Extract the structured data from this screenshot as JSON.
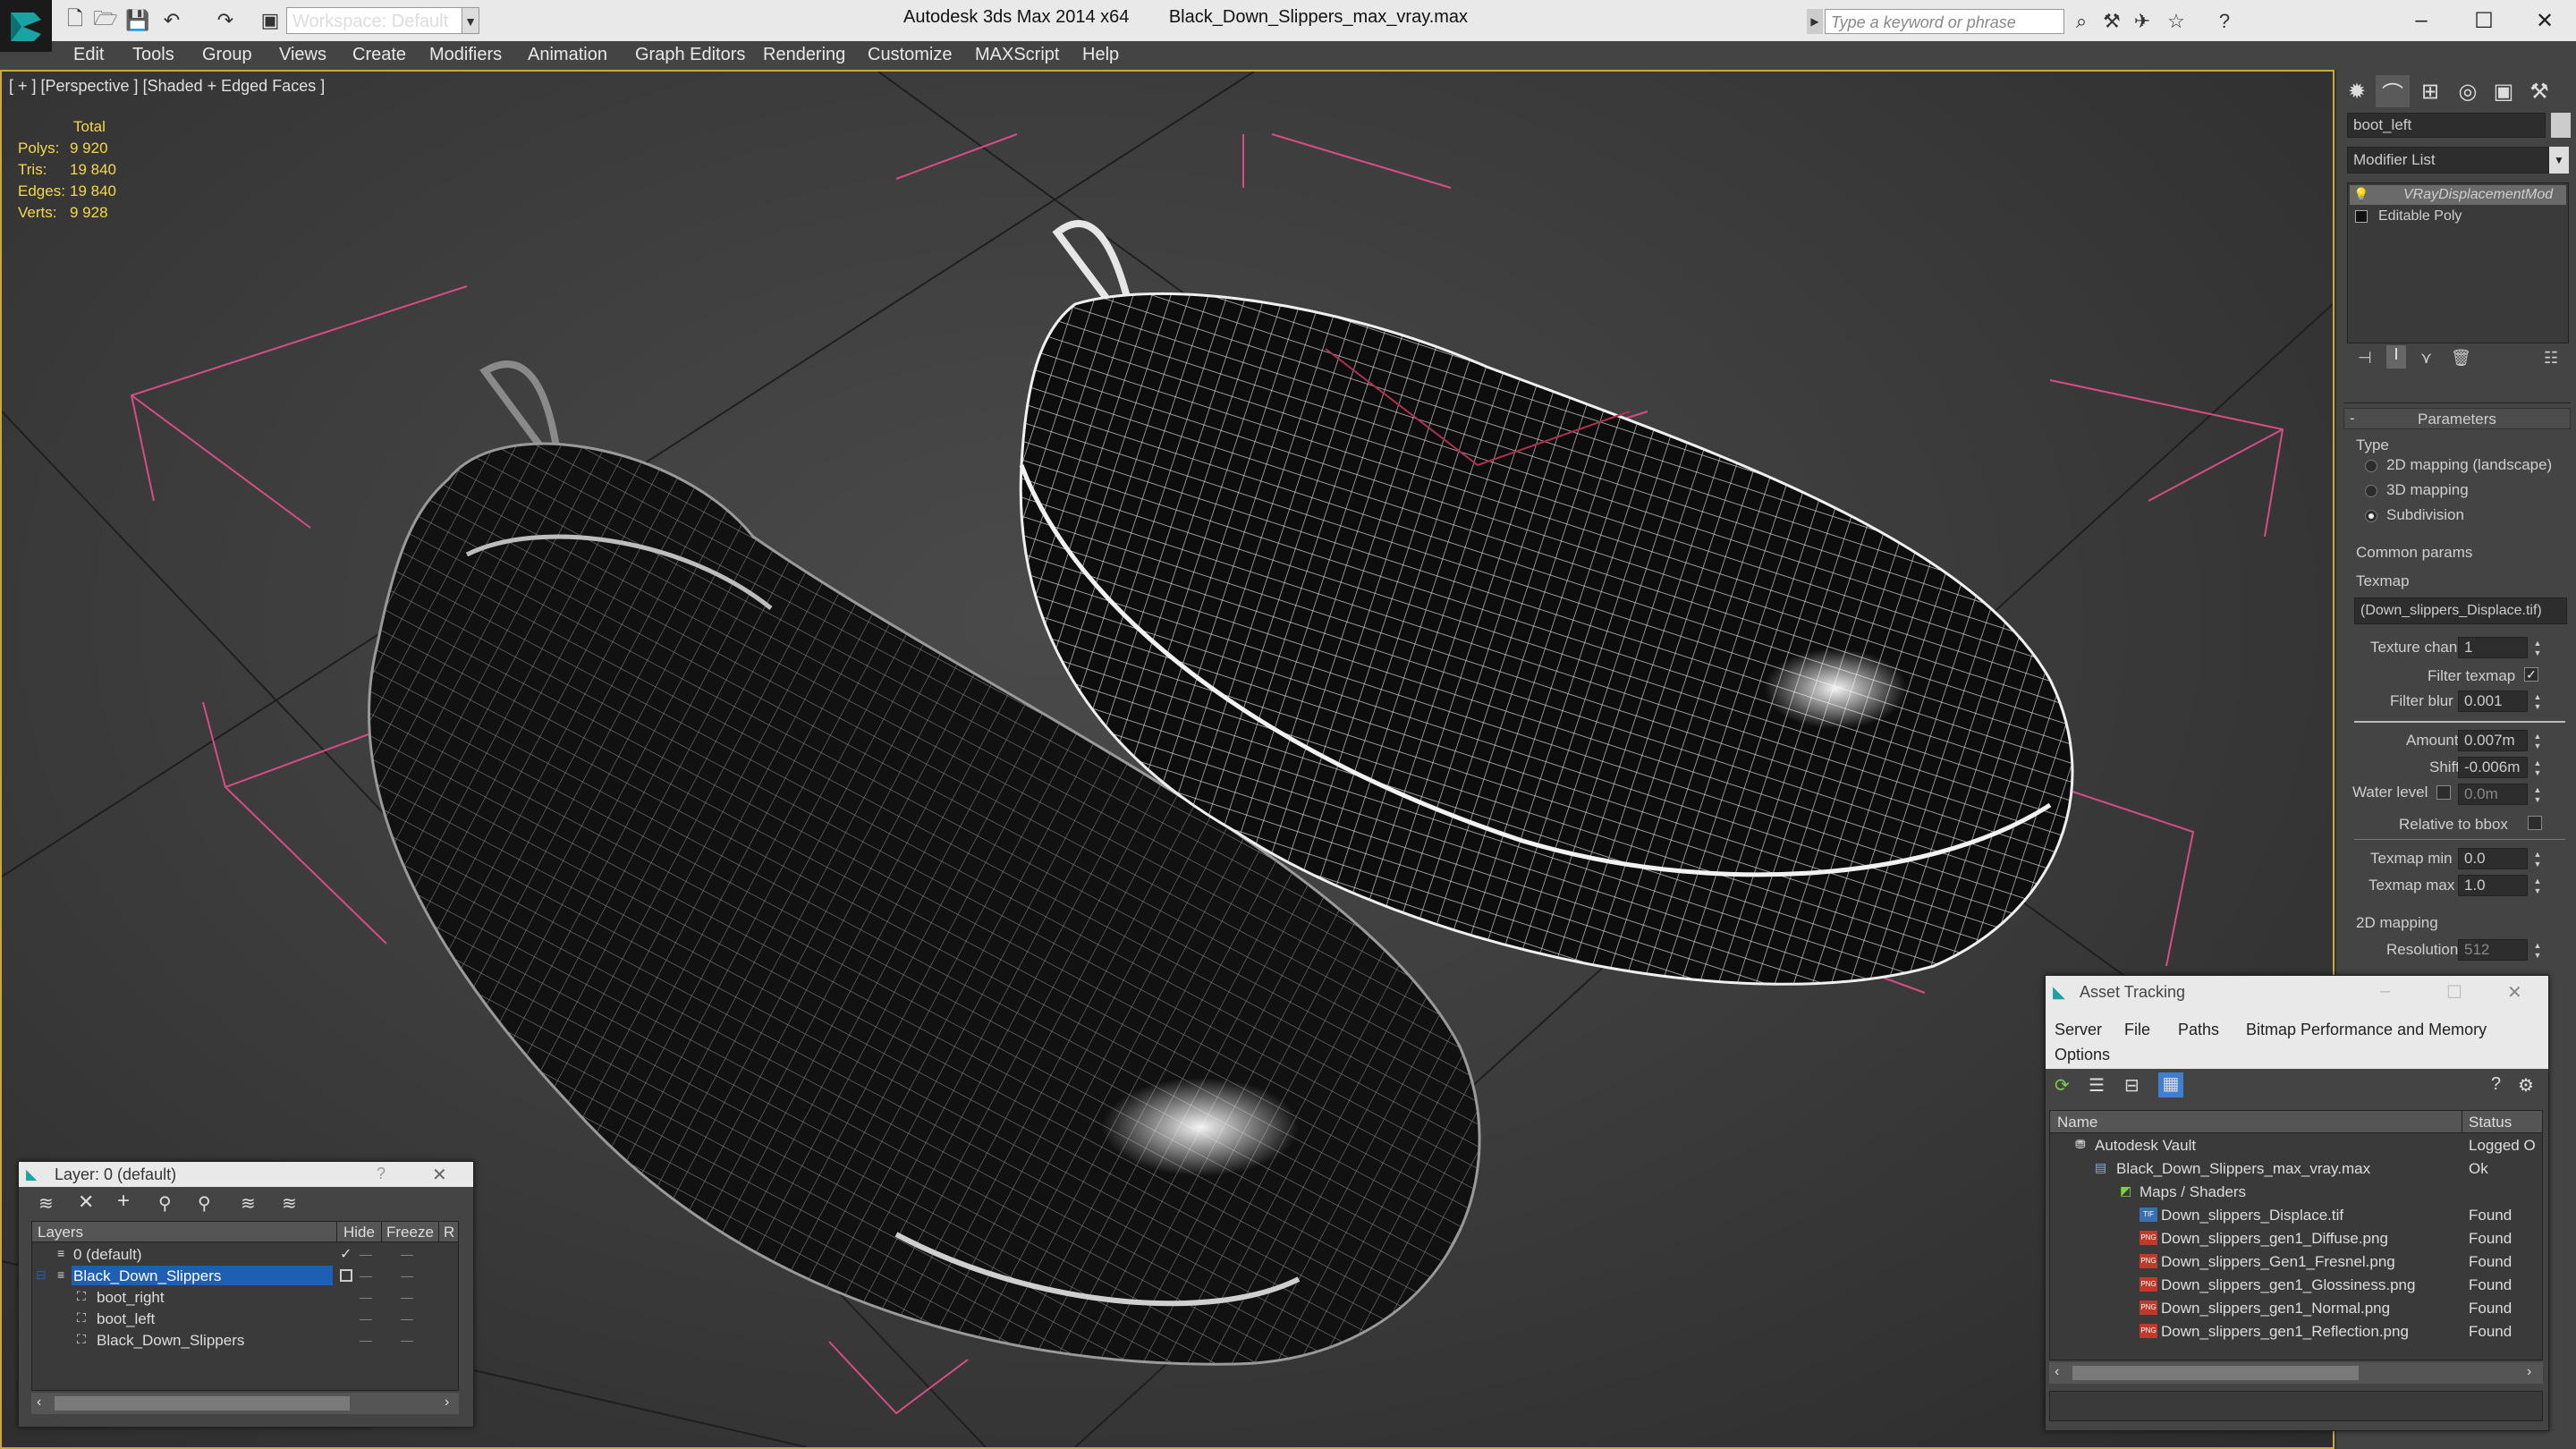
{
  "app": {
    "title": "Autodesk 3ds Max 2014 x64",
    "file": "Black_Down_Slippers_max_vray.max",
    "workspace": "Workspace: Default",
    "search_placeholder": "Type a keyword or phrase"
  },
  "menu": [
    "Edit",
    "Tools",
    "Group",
    "Views",
    "Create",
    "Modifiers",
    "Animation",
    "Graph Editors",
    "Rendering",
    "Customize",
    "MAXScript",
    "Help"
  ],
  "viewport": {
    "label": "[ + ] [Perspective ] [Shaded + Edged Faces ]",
    "stats": {
      "header": "Total",
      "rows": [
        {
          "label": "Polys:",
          "value": "9 920"
        },
        {
          "label": "Tris:",
          "value": "19 840"
        },
        {
          "label": "Edges:",
          "value": "19 840"
        },
        {
          "label": "Verts:",
          "value": "9 928"
        }
      ]
    }
  },
  "command_panel": {
    "object_name": "boot_left",
    "modifier_list": "Modifier List",
    "stack": [
      "VRayDisplacementMod",
      "Editable Poly"
    ],
    "parameters_title": "Parameters",
    "type_label": "Type",
    "type_options": [
      "2D mapping (landscape)",
      "3D mapping",
      "Subdivision"
    ],
    "type_selected": "Subdivision",
    "common_params": "Common params",
    "texmap_label": "Texmap",
    "texmap_value": "(Down_slippers_Displace.tif)",
    "texture_chan_label": "Texture chan",
    "texture_chan": "1",
    "filter_texmap_label": "Filter texmap",
    "filter_blur_label": "Filter blur",
    "filter_blur": "0.001",
    "amount_label": "Amount",
    "amount": "0.007m",
    "shift_label": "Shift",
    "shift": "-0.006m",
    "water_level_label": "Water level",
    "water_level": "0.0m",
    "relative_bbox_label": "Relative to bbox",
    "texmap_min_label": "Texmap min",
    "texmap_min": "0.0",
    "texmap_max_label": "Texmap max",
    "texmap_max": "1.0",
    "mapping_2d": "2D mapping",
    "resolution_label": "Resolution",
    "resolution": "512"
  },
  "layer_window": {
    "title": "Layer: 0 (default)",
    "help": "?",
    "columns": [
      "Layers",
      "Hide",
      "Freeze",
      "R"
    ],
    "rows": [
      {
        "name": "0 (default)",
        "indent": 0,
        "selected": false
      },
      {
        "name": "Black_Down_Slippers",
        "indent": 0,
        "selected": true
      },
      {
        "name": "boot_right",
        "indent": 1,
        "selected": false
      },
      {
        "name": "boot_left",
        "indent": 1,
        "selected": false
      },
      {
        "name": "Black_Down_Slippers",
        "indent": 1,
        "selected": false
      }
    ]
  },
  "asset_window": {
    "title": "Asset Tracking",
    "menu": [
      "Server",
      "File",
      "Paths",
      "Bitmap Performance and Memory",
      "Options"
    ],
    "columns": [
      "Name",
      "Status"
    ],
    "rows": [
      {
        "name": "Autodesk Vault",
        "status": "Logged O",
        "indent": 0,
        "type": "vault"
      },
      {
        "name": "Black_Down_Slippers_max_vray.max",
        "status": "Ok",
        "indent": 1,
        "type": "max"
      },
      {
        "name": "Maps / Shaders",
        "status": "",
        "indent": 2,
        "type": "folder"
      },
      {
        "name": "Down_slippers_Displace.tif",
        "status": "Found",
        "indent": 3,
        "type": "TIF"
      },
      {
        "name": "Down_slippers_gen1_Diffuse.png",
        "status": "Found",
        "indent": 3,
        "type": "PNG"
      },
      {
        "name": "Down_slippers_Gen1_Fresnel.png",
        "status": "Found",
        "indent": 3,
        "type": "PNG"
      },
      {
        "name": "Down_slippers_gen1_Glossiness.png",
        "status": "Found",
        "indent": 3,
        "type": "PNG"
      },
      {
        "name": "Down_slippers_gen1_Normal.png",
        "status": "Found",
        "indent": 3,
        "type": "PNG"
      },
      {
        "name": "Down_slippers_gen1_Reflection.png",
        "status": "Found",
        "indent": 3,
        "type": "PNG"
      }
    ]
  },
  "colors": {
    "stats_yellow": "#f5d84a",
    "selection_blue": "#1e5fb3",
    "bbox_pink": "#d84c86",
    "viewport_border": "#c9a93a"
  }
}
